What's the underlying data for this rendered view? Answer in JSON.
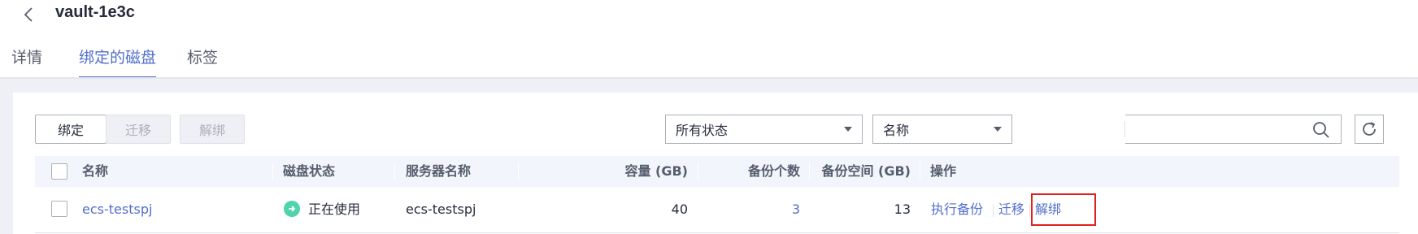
{
  "header": {
    "title": "vault-1e3c",
    "back_icon": "chevron-left-icon"
  },
  "tabs": [
    {
      "label": "详情",
      "active": false
    },
    {
      "label": "绑定的磁盘",
      "active": true
    },
    {
      "label": "标签",
      "active": false
    }
  ],
  "toolbar": {
    "bind_label": "绑定",
    "migrate_label": "迁移",
    "unbind_label": "解绑",
    "status_filter": "所有状态",
    "search_field": "名称",
    "search_value": "",
    "search_icon": "search-icon",
    "refresh_icon": "refresh-icon"
  },
  "table": {
    "columns": [
      "名称",
      "磁盘状态",
      "服务器名称",
      "容量 (GB)",
      "备份个数",
      "备份空间 (GB)",
      "操作"
    ],
    "rows": [
      {
        "name": "ecs-testspj",
        "status": "正在使用",
        "status_icon": "arrow-right-circle-icon",
        "server": "ecs-testspj",
        "capacity": "40",
        "backup_count": "3",
        "backup_space": "13",
        "actions": [
          "执行备份",
          "迁移",
          "解绑"
        ]
      }
    ]
  },
  "colors": {
    "accent": "#526ecc",
    "status_ok": "#50d4ab",
    "highlight": "#e02020"
  }
}
